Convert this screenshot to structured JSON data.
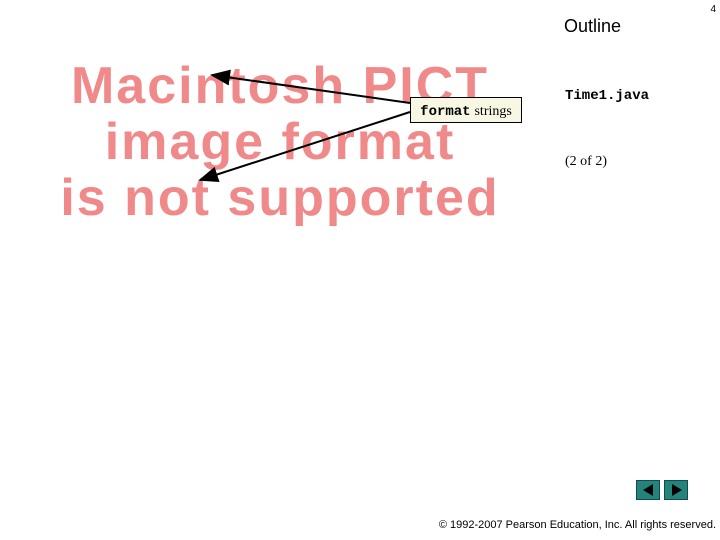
{
  "slide": {
    "page_number": "4",
    "outline_title": "Outline"
  },
  "placeholder_image": {
    "lines": [
      "Macintosh PICT",
      "image format",
      "is not supported"
    ]
  },
  "callout": {
    "code": "format",
    "text": "strings"
  },
  "side_panel": {
    "file_name": "Time1.java",
    "part_label": "(2 of 2)"
  },
  "nav": {
    "prev_icon": "triangle-left-icon",
    "next_icon": "triangle-right-icon",
    "button_color": "#24847c"
  },
  "footer": {
    "copyright": "© 1992-2007 Pearson Education, Inc. All rights reserved."
  }
}
